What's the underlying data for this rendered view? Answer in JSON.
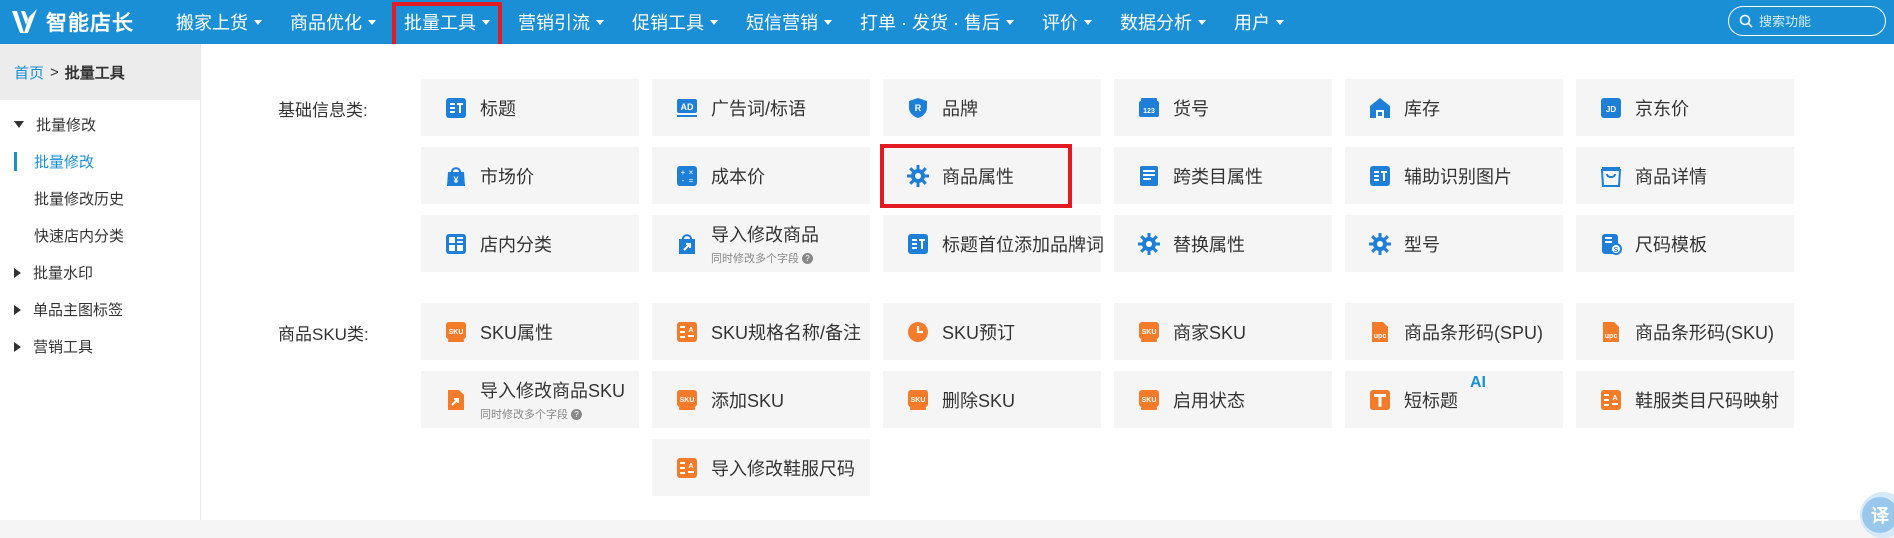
{
  "app": {
    "logo_text": "智能店长"
  },
  "nav": [
    {
      "label": "搬家上货"
    },
    {
      "label": "商品优化"
    },
    {
      "label": "批量工具"
    },
    {
      "label": "营销引流"
    },
    {
      "label": "促销工具"
    },
    {
      "label": "短信营销"
    },
    {
      "label": "打单 · 发货 · 售后"
    },
    {
      "label": "评价"
    },
    {
      "label": "数据分析"
    },
    {
      "label": "用户"
    }
  ],
  "search": {
    "placeholder": "搜索功能"
  },
  "breadcrumb": {
    "home": "首页",
    "sep": ">",
    "current": "批量工具"
  },
  "sidebar": {
    "group1": "批量修改",
    "sub1": "批量修改",
    "sub2": "批量修改历史",
    "sub3": "快速店内分类",
    "group2": "批量水印",
    "group3": "单品主图标签",
    "group4": "营销工具"
  },
  "sections": {
    "basic": {
      "label": "基础信息类:",
      "items": [
        {
          "label": "标题",
          "icon": "title-icon"
        },
        {
          "label": "广告词/标语",
          "icon": "ad-icon"
        },
        {
          "label": "品牌",
          "icon": "brand-icon"
        },
        {
          "label": "货号",
          "icon": "item-number-icon"
        },
        {
          "label": "库存",
          "icon": "stock-icon"
        },
        {
          "label": "京东价",
          "icon": "jd-price-icon"
        },
        {
          "label": "市场价",
          "icon": "market-price-icon"
        },
        {
          "label": "成本价",
          "icon": "cost-price-icon"
        },
        {
          "label": "商品属性",
          "icon": "gear-icon"
        },
        {
          "label": "跨类目属性",
          "icon": "cross-category-icon"
        },
        {
          "label": "辅助识别图片",
          "icon": "image-icon"
        },
        {
          "label": "商品详情",
          "icon": "bag-icon"
        },
        {
          "label": "店内分类",
          "icon": "category-icon"
        },
        {
          "label": "导入修改商品",
          "sub": "同时修改多个字段",
          "icon": "import-icon"
        },
        {
          "label": "标题首位添加品牌词",
          "icon": "title-icon"
        },
        {
          "label": "替换属性",
          "icon": "gear-icon"
        },
        {
          "label": "型号",
          "icon": "gear-icon"
        },
        {
          "label": "尺码模板",
          "icon": "size-template-icon"
        }
      ]
    },
    "sku": {
      "label": "商品SKU类:",
      "items": [
        {
          "label": "SKU属性",
          "icon": "sku-icon"
        },
        {
          "label": "SKU规格名称/备注",
          "icon": "sku-spec-icon"
        },
        {
          "label": "SKU预订",
          "icon": "clock-icon"
        },
        {
          "label": "商家SKU",
          "icon": "sku-icon"
        },
        {
          "label": "商品条形码(SPU)",
          "icon": "upc-icon"
        },
        {
          "label": "商品条形码(SKU)",
          "icon": "upc-icon"
        },
        {
          "label": "导入修改商品SKU",
          "sub": "同时修改多个字段",
          "icon": "import-file-icon"
        },
        {
          "label": "添加SKU",
          "icon": "sku-icon"
        },
        {
          "label": "删除SKU",
          "icon": "sku-icon"
        },
        {
          "label": "启用状态",
          "icon": "sku-icon"
        },
        {
          "label": "短标题",
          "icon": "short-title-icon",
          "badge": "AI"
        },
        {
          "label": "鞋服类目尺码映射",
          "icon": "sku-spec-icon"
        },
        {
          "label": "导入修改鞋服尺码",
          "icon": "sku-spec-icon"
        }
      ]
    }
  },
  "translate_button": "译",
  "colors": {
    "nav_bg": "#1a8fd6",
    "accent": "#1a8fd6",
    "icon_blue": "#1e7fd8",
    "icon_orange": "#f47b2a",
    "highlight": "#e31b23"
  }
}
